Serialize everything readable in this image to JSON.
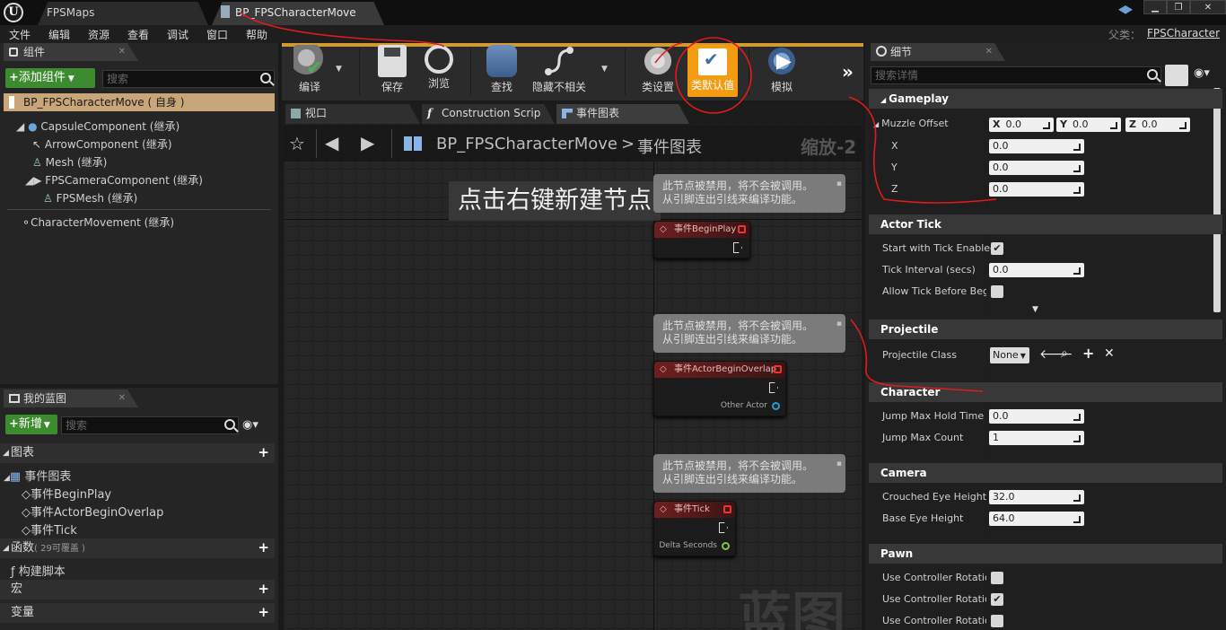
{
  "titlebar": {
    "tabs": [
      {
        "label": "FPSMaps"
      },
      {
        "label": "BP_FPSCharacterMove"
      }
    ]
  },
  "menu": {
    "items": [
      "文件",
      "编辑",
      "资源",
      "查看",
      "调试",
      "窗口",
      "帮助"
    ],
    "parent_label": "父类：",
    "parent_value": "FPSCharacter"
  },
  "components_panel": {
    "tab": "组件",
    "add_button": "添加组件",
    "search_placeholder": "搜索",
    "root": "BP_FPSCharacterMove ( 自身 )",
    "items": [
      "CapsuleComponent (继承)",
      "ArrowComponent (继承)",
      "Mesh (继承)",
      "FPSCameraComponent (继承)",
      "FPSMesh (继承)",
      "CharacterMovement (继承)"
    ]
  },
  "my_blueprint": {
    "tab": "我的蓝图",
    "new_button": "新增",
    "search_placeholder": "搜索",
    "graphs_label": "图表",
    "event_graph": "事件图表",
    "events": [
      "事件BeginPlay",
      "事件ActorBeginOverlap",
      "事件Tick"
    ],
    "functions_label": "函数",
    "functions_hint": "( 29可覆盖 )",
    "construct_script": "构建脚本",
    "macros_label": "宏",
    "variables_label": "变量"
  },
  "toolbar": {
    "buttons": [
      "编译",
      "保存",
      "浏览",
      "查找",
      "隐藏不相关",
      "类设置",
      "类默认值",
      "模拟"
    ]
  },
  "editor_tabs": [
    "视口",
    "Construction Scrip",
    "事件图表"
  ],
  "graph": {
    "breadcrumb_root": "BP_FPSCharacterMove",
    "breadcrumb_sep": ">",
    "breadcrumb_current": "事件图表",
    "zoom": "缩放-2",
    "hint": "点击右键新建节点",
    "watermark": "蓝图",
    "comment_text_line1": "此节点被禁用，将不会被调用。",
    "comment_text_line2": "从引脚连出引线来编译功能。",
    "nodes": [
      {
        "title": "事件BeginPlay"
      },
      {
        "title": "事件ActorBeginOverlap",
        "pin": "Other Actor"
      },
      {
        "title": "事件Tick",
        "pin": "Delta Seconds"
      }
    ]
  },
  "details": {
    "tab": "细节",
    "search_placeholder": "搜索详情",
    "categories": {
      "gameplay": "Gameplay",
      "actor_tick": "Actor Tick",
      "projectile": "Projectile",
      "character": "Character",
      "camera": "Camera",
      "pawn": "Pawn"
    },
    "muzzle_offset": {
      "label": "Muzzle Offset",
      "x_label": "X",
      "y_label": "Y",
      "z_label": "Z",
      "x": "0.0",
      "y": "0.0",
      "z": "0.0"
    },
    "start_tick_label": "Start with Tick Enabled",
    "tick_interval_label": "Tick Interval (secs)",
    "tick_interval": "0.0",
    "allow_tick_label": "Allow Tick Before Begin",
    "projectile_class_label": "Projectile Class",
    "projectile_class": "None",
    "jump_hold_label": "Jump Max Hold Time",
    "jump_hold": "0.0",
    "jump_count_label": "Jump Max Count",
    "jump_count": "1",
    "crouched_label": "Crouched Eye Height",
    "crouched": "32.0",
    "base_eye_label": "Base Eye Height",
    "base_eye": "64.0",
    "pawn_rows": [
      "Use Controller Rotation",
      "Use Controller Rotation",
      "Use Controller Rotation"
    ]
  },
  "colors": {
    "accent_orange": "#f39c12",
    "green": "#3d8b2f",
    "annotation_red": "#e01b1b"
  }
}
